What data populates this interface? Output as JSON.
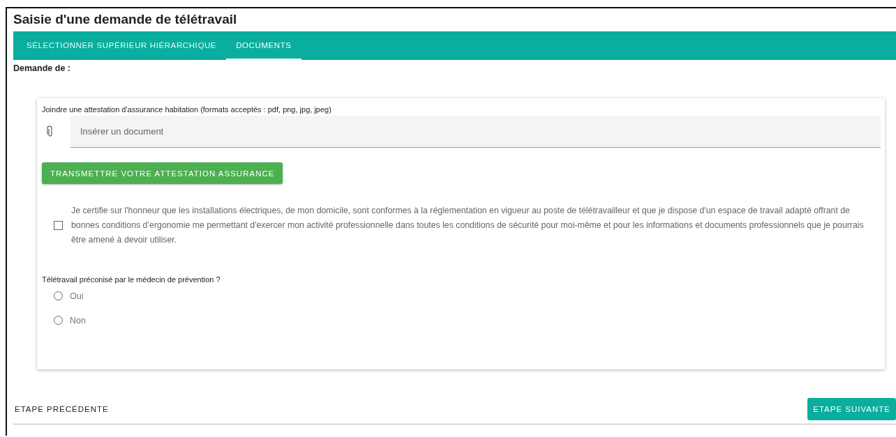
{
  "title": "Saisie d'une demande de télétravail",
  "tabs": [
    {
      "label": "SÉLECTIONNER SUPÉRIEUR HIÉRARCHIQUE",
      "selected": false
    },
    {
      "label": "DOCUMENTS",
      "selected": true
    }
  ],
  "requester_label": "Demande de :",
  "upload": {
    "label": "Joindre une attestation d'assurance habitation (formats acceptés : pdf, png, jpg, jpeg)",
    "placeholder": "Insérer un document",
    "button": "TRANSMETTRE VOTRE ATTESTATION ASSURANCE"
  },
  "certification": {
    "checked": false,
    "text": "Je certifie sur l'honneur que les installations électriques, de mon domicile, sont conformes à la réglementation en vigueur au poste de télétravailleur et que je dispose d'un espace de travail adapté offrant de bonnes conditions d’ergonomie me permettant d'exercer mon activité professionnelle dans toutes les conditions de sécurité pour moi-même et pour les informations et documents professionnels que je pourrais être amené à devoir utiliser."
  },
  "question": {
    "label": "Télétravail préconisé par le médecin de prévention ?",
    "options": [
      {
        "label": "Oui",
        "selected": false
      },
      {
        "label": "Non",
        "selected": false
      }
    ]
  },
  "footer": {
    "previous": "ETAPE PRÉCÉDENTE",
    "next": "ETAPE SUIVANTE"
  }
}
